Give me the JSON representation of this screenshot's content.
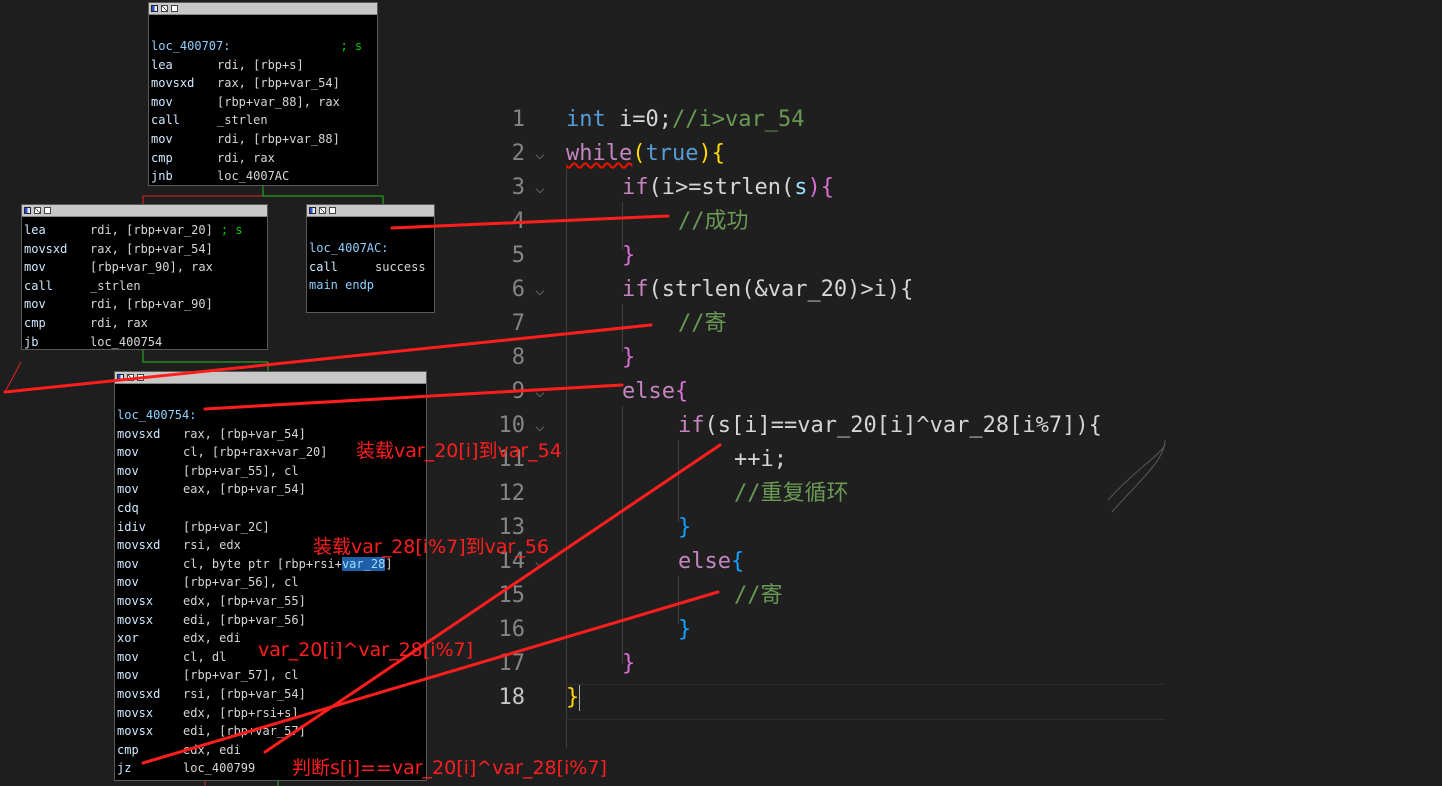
{
  "ida_blocks": [
    {
      "lines": [
        {
          "label": "loc_400707:",
          "comment": "; s"
        },
        {
          "op": "lea",
          "arg": "rdi, [rbp+s]"
        },
        {
          "op": "movsxd",
          "arg": "rax, [rbp+var_54]"
        },
        {
          "op": "mov",
          "arg": "[rbp+var_88], rax"
        },
        {
          "op": "call",
          "arg": "_strlen"
        },
        {
          "op": "mov",
          "arg": "rdi, [rbp+var_88]"
        },
        {
          "op": "cmp",
          "arg": "rdi, rax"
        },
        {
          "op": "jnb",
          "arg": "loc_4007AC"
        }
      ]
    },
    {
      "lines": [
        {
          "op": "lea",
          "arg": "rdi, [rbp+var_20]",
          "comment": "; s"
        },
        {
          "op": "movsxd",
          "arg": "rax, [rbp+var_54]"
        },
        {
          "op": "mov",
          "arg": "[rbp+var_90], rax"
        },
        {
          "op": "call",
          "arg": "_strlen"
        },
        {
          "op": "mov",
          "arg": "rdi, [rbp+var_90]"
        },
        {
          "op": "cmp",
          "arg": "rdi, rax"
        },
        {
          "op": "jb",
          "arg": "loc_400754"
        }
      ]
    },
    {
      "lines": [
        {
          "label": "loc_4007AC:"
        },
        {
          "op": "call",
          "arg": "success"
        },
        {
          "label": "main endp"
        }
      ]
    },
    {
      "lines": [
        {
          "label": "loc_400754:"
        },
        {
          "op": "movsxd",
          "arg": "rax, [rbp+var_54]"
        },
        {
          "op": "mov",
          "arg": "cl, [rbp+rax+var_20]"
        },
        {
          "op": "mov",
          "arg": "[rbp+var_55], cl"
        },
        {
          "op": "mov",
          "arg": "eax, [rbp+var_54]"
        },
        {
          "op": "cdq",
          "arg": ""
        },
        {
          "op": "idiv",
          "arg": "[rbp+var_2C]"
        },
        {
          "op": "movsxd",
          "arg": "rsi, edx"
        },
        {
          "op": "mov",
          "arg": "cl, byte ptr [rbp+rsi+var_28]"
        },
        {
          "op": "mov",
          "arg": "[rbp+var_56], cl"
        },
        {
          "op": "movsx",
          "arg": "edx, [rbp+var_55]"
        },
        {
          "op": "movsx",
          "arg": "edi, [rbp+var_56]"
        },
        {
          "op": "xor",
          "arg": "edx, edi"
        },
        {
          "op": "mov",
          "arg": "cl, dl"
        },
        {
          "op": "mov",
          "arg": "[rbp+var_57], cl"
        },
        {
          "op": "movsxd",
          "arg": "rsi, [rbp+var_54]"
        },
        {
          "op": "movsx",
          "arg": "edx, [rbp+rsi+s]"
        },
        {
          "op": "movsx",
          "arg": "edi, [rbp+var_57]"
        },
        {
          "op": "cmp",
          "arg": "edx, edi"
        },
        {
          "op": "jz",
          "arg": "loc_400799"
        }
      ]
    }
  ],
  "editor": {
    "line_numbers": [
      "1",
      "2",
      "3",
      "4",
      "5",
      "6",
      "7",
      "8",
      "9",
      "10",
      "11",
      "12",
      "13",
      "14",
      "15",
      "16",
      "17",
      "18"
    ],
    "current_line": "18"
  },
  "code": {
    "l1": {
      "kw": "int",
      "rest": " i=0;",
      "cmt": "//i>var_54"
    },
    "l2": {
      "kw": "while",
      "p1": "(",
      "kw2": "true",
      "p2": ")",
      "br": "{"
    },
    "l3": {
      "kw": "if",
      "rest": "(i>=strlen",
      "a": "(",
      "b": "s",
      ")": ")",
      "c": "){"
    },
    "l4": {
      "cmt": "//成功"
    },
    "l5": {
      "br": "}"
    },
    "l6": {
      "kw": "if",
      "rest": "(strlen(&var_20)>i){"
    },
    "l7": {
      "cmt": "//寄"
    },
    "l8": {
      "br": "}"
    },
    "l9": {
      "kw": "else",
      "br": "{"
    },
    "l10": {
      "kw": "if",
      "rest": "(s[i]==var_20[i]^var_28[i%7]){"
    },
    "l11": {
      "rest": "++i;"
    },
    "l12": {
      "cmt": "//重复循环"
    },
    "l13": {
      "br": "}"
    },
    "l14": {
      "kw": "else",
      "br": "{"
    },
    "l15": {
      "cmt": "//寄"
    },
    "l16": {
      "br": "}"
    },
    "l17": {
      "br": "}"
    },
    "l18": {
      "br": "}"
    }
  },
  "annotations": {
    "a1": "装载var_20[i]到var_54",
    "a2": "装载var_28[i%7]到var_56",
    "a3": "var_20[i]^var_28[i%7]",
    "a4": "判断s[i]==var_20[i]^var_28[i%7]"
  },
  "colors": {
    "annotation": "#ff1e1e",
    "background": "#1e1e1e"
  }
}
